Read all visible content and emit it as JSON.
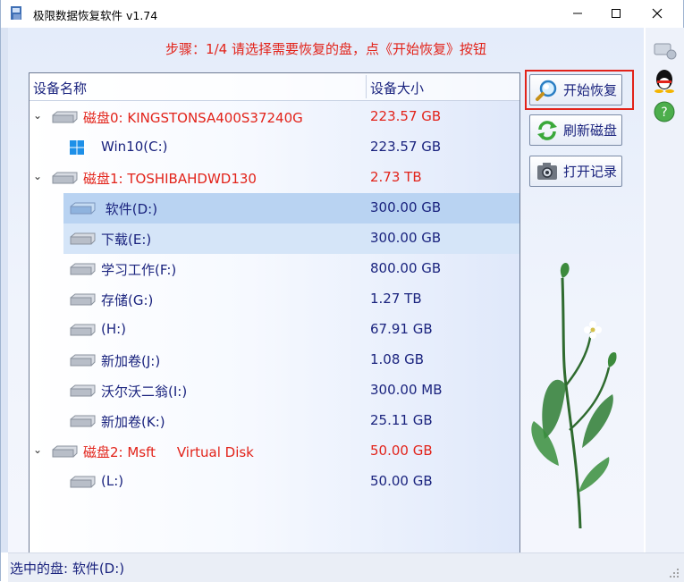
{
  "window": {
    "title": "极限数据恢复软件 v1.74"
  },
  "step_text": "步骤：1/4 请选择需要恢复的盘，点《开始恢复》按钮",
  "list": {
    "header_name": "设备名称",
    "header_size": "设备大小",
    "rows": [
      {
        "label": "磁盘0: KINGSTONSA400S37240G",
        "size": "223.57 GB"
      },
      {
        "label": "Win10(C:)",
        "size": "223.57 GB"
      },
      {
        "label": "磁盘1: TOSHIBAHDWD130",
        "size": "2.73 TB"
      },
      {
        "label": " 软件(D:)",
        "size": "300.00 GB"
      },
      {
        "label": "下载(E:)",
        "size": "300.00 GB"
      },
      {
        "label": "学习工作(F:)",
        "size": "800.00 GB"
      },
      {
        "label": "存储(G:)",
        "size": "1.27 TB"
      },
      {
        "label": "(H:)",
        "size": "67.91 GB"
      },
      {
        "label": "新加卷(J:)",
        "size": "1.08 GB"
      },
      {
        "label": "沃尔沃二翁(I:)",
        "size": "300.00 MB"
      },
      {
        "label": "新加卷(K:)",
        "size": "25.11 GB"
      },
      {
        "label": "磁盘2: Msft     Virtual Disk",
        "size": "50.00 GB"
      },
      {
        "label": "(L:)",
        "size": "50.00 GB"
      }
    ]
  },
  "buttons": {
    "start_recovery": "开始恢复",
    "refresh_disks": "刷新磁盘",
    "open_records": "打开记录"
  },
  "status": {
    "selected": "选中的盘: 软件(D:)"
  },
  "colors": {
    "accent_red": "#e2231a",
    "text_blue": "#1a237e",
    "selection": "#b9d3f2"
  }
}
